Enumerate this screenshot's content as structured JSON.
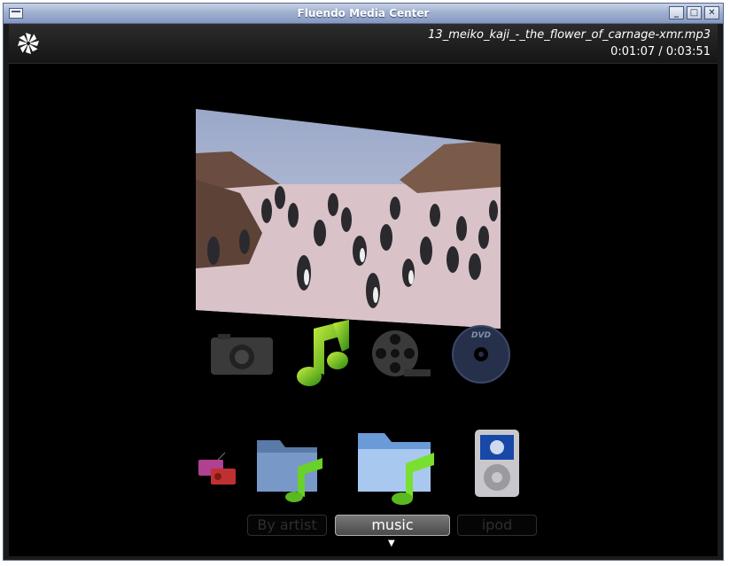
{
  "window": {
    "title": "Fluendo Media Center"
  },
  "now_playing": {
    "track": "13_meiko_kaji_-_the_flower_of_carnage-xmr.mp3",
    "time": "0:01:07 / 0:03:51"
  },
  "preview": {
    "icon": "penguins-photo-preview"
  },
  "categories": [
    {
      "name": "photos",
      "icon": "camera-icon"
    },
    {
      "name": "music",
      "icon": "music-note-icon"
    },
    {
      "name": "videos",
      "icon": "film-reel-icon"
    },
    {
      "name": "dvd",
      "icon": "dvd-disc-icon",
      "label": "DVD"
    }
  ],
  "sources": {
    "items": [
      {
        "label": "By artist",
        "icon": "folder-music-icon"
      },
      {
        "label": "music",
        "icon": "folder-music-icon"
      },
      {
        "label": "ipod",
        "icon": "ipod-icon"
      }
    ],
    "selected": "music",
    "prev_icon": "radio-icon"
  }
}
